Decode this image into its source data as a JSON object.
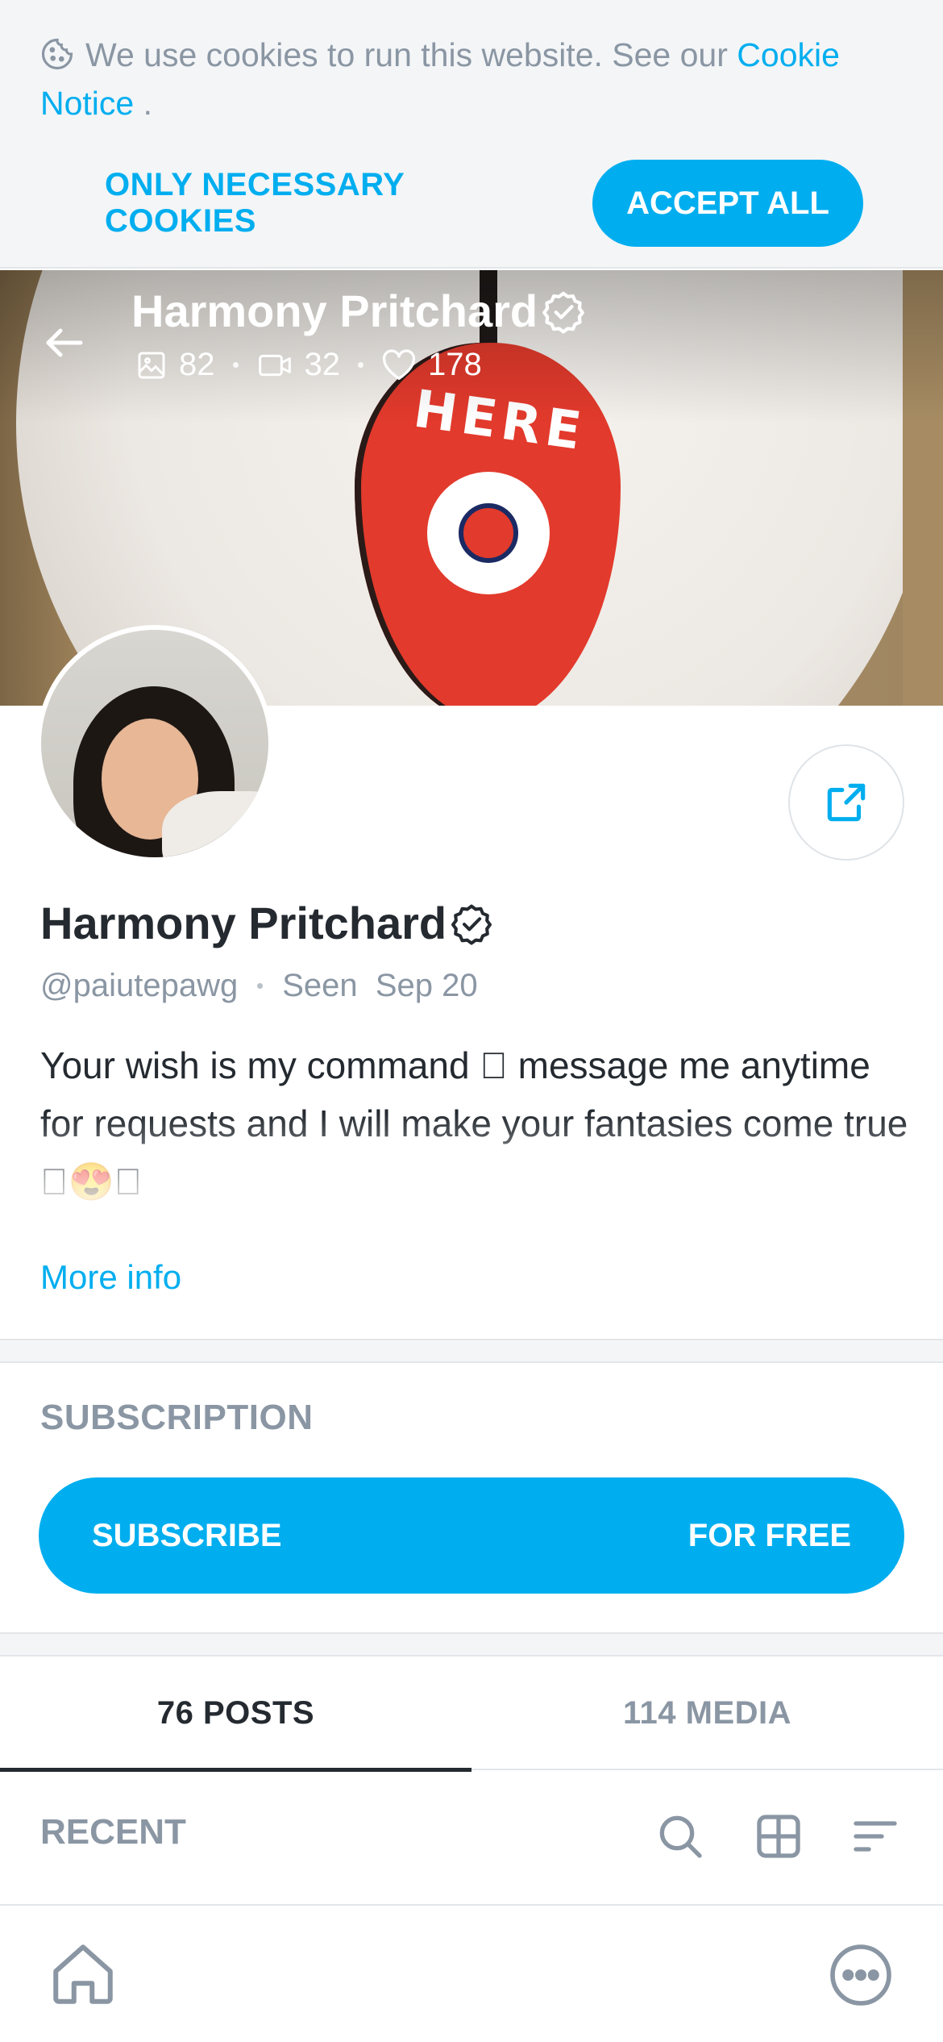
{
  "cookie_banner": {
    "text": "We use cookies to run this website. See our",
    "link_text": "Cookie Notice",
    "after_link": " .",
    "necessary_label": "ONLY NECESSARY COOKIES",
    "accept_label": "ACCEPT ALL"
  },
  "cover": {
    "name": "Harmony Pritchard",
    "stats": {
      "photos": "82",
      "videos": "32",
      "likes": "178"
    },
    "image_text": "HERE"
  },
  "profile": {
    "name": "Harmony Pritchard",
    "handle": "@paiutepawg",
    "seen_label": "Seen",
    "seen_date": "Sep 20",
    "bio": "Your wish is my command 􏿾 message me anytime for requests and I will make your fantasies come true 􏿾😍􏿾",
    "more_info": "More info"
  },
  "subscription": {
    "title": "SUBSCRIPTION",
    "button_left": "SUBSCRIBE",
    "button_right": "FOR FREE"
  },
  "tabs": [
    {
      "label": "76 POSTS",
      "active": true
    },
    {
      "label": "114 MEDIA",
      "active": false
    }
  ],
  "recent": {
    "label": "RECENT"
  },
  "colors": {
    "accent": "#00aeef",
    "text": "#242a30",
    "muted": "#8a96a3"
  },
  "icons": [
    "cookie-icon",
    "back-arrow-icon",
    "verified-badge-icon",
    "image-icon",
    "video-icon",
    "heart-icon",
    "share-icon",
    "search-icon",
    "grid-icon",
    "sort-icon",
    "home-icon",
    "more-icon"
  ]
}
